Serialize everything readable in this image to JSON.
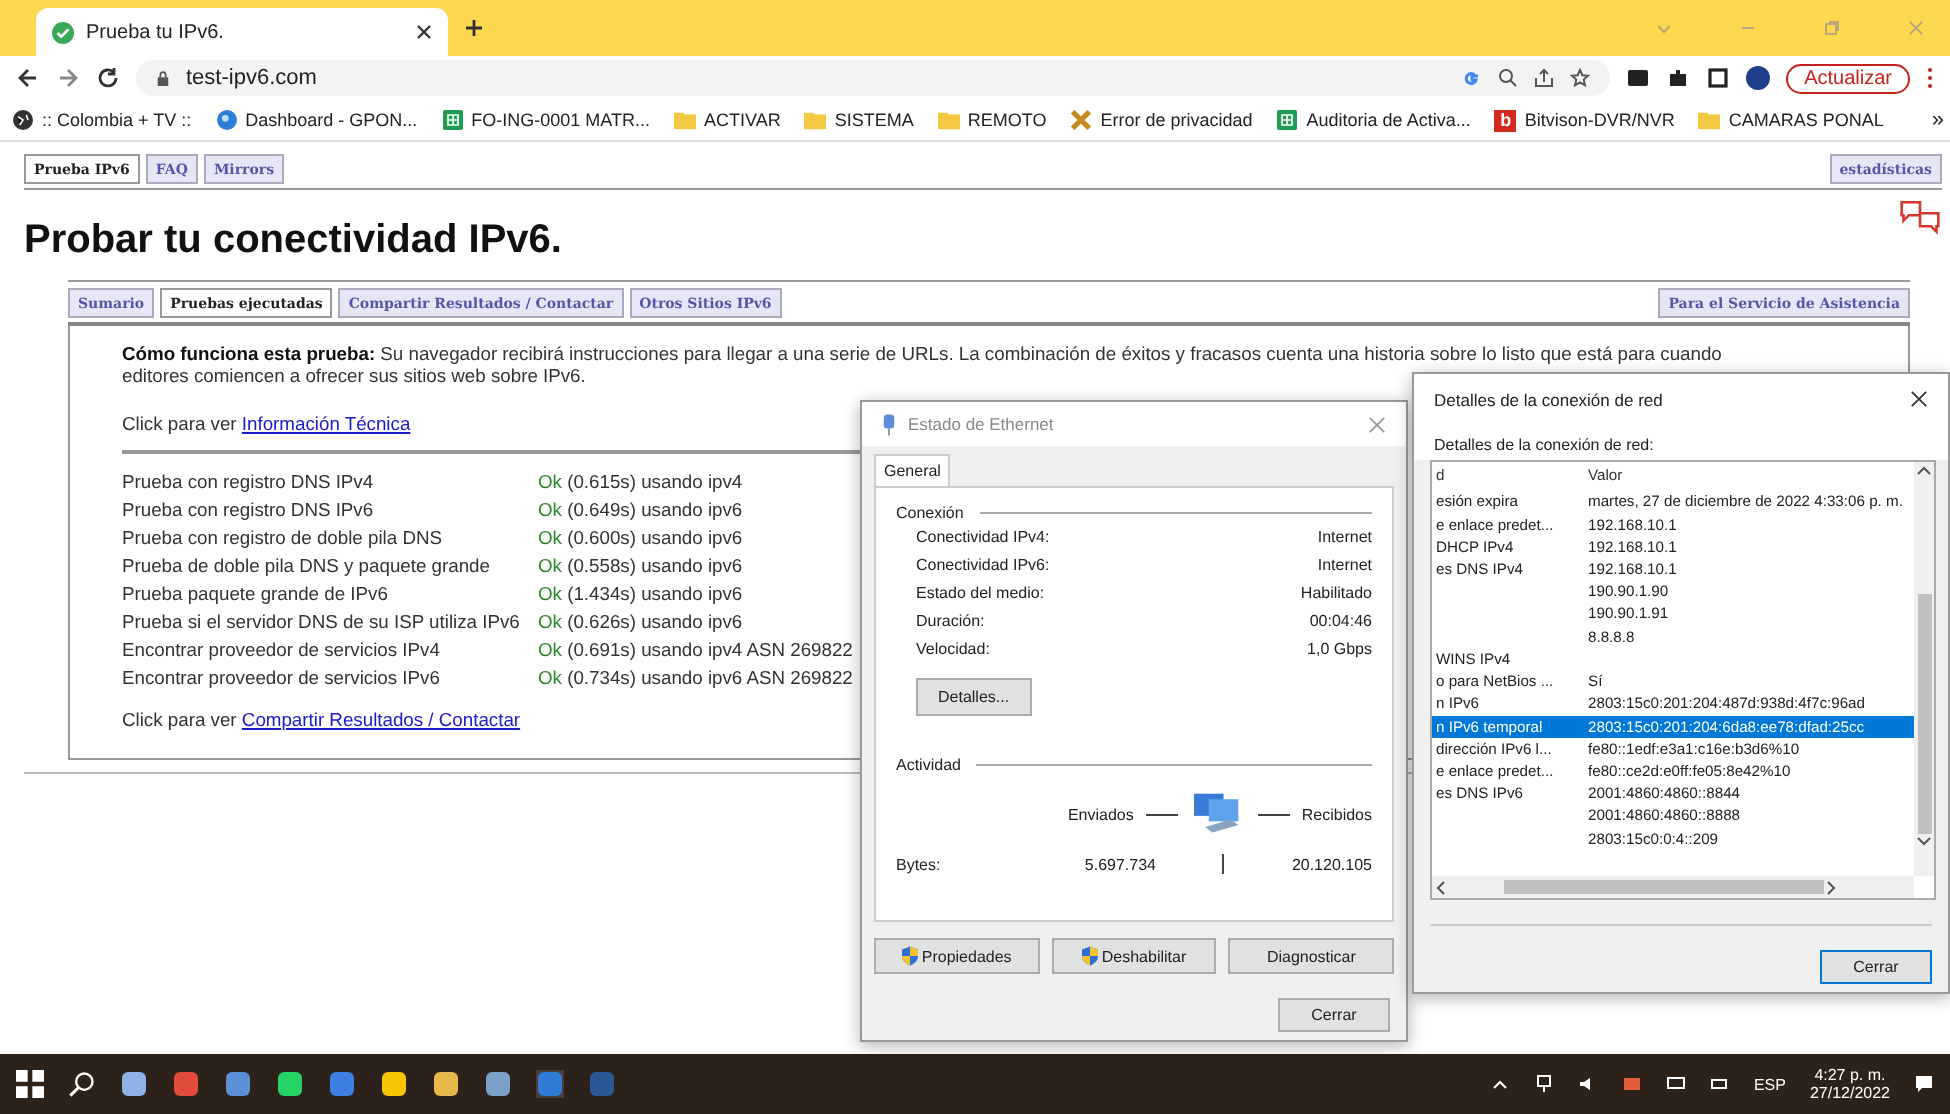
{
  "browser": {
    "tabs": [
      {
        "title": "Prueba tu IPv6.",
        "selected": true
      }
    ],
    "url": "test-ipv6.com",
    "update_button": "Actualizar",
    "bookmarks": [
      {
        "kind": "globe",
        "label": ":: Colombia + TV ::"
      },
      {
        "kind": "orb",
        "label": "Dashboard - GPON..."
      },
      {
        "kind": "sheet",
        "label": "FO-ING-0001 MATR..."
      },
      {
        "kind": "folder",
        "label": "ACTIVAR"
      },
      {
        "kind": "folder",
        "label": "SISTEMA"
      },
      {
        "kind": "folder",
        "label": "REMOTO"
      },
      {
        "kind": "warning",
        "label": "Error de privacidad"
      },
      {
        "kind": "sheet",
        "label": "Auditoria de Activa..."
      },
      {
        "kind": "letter",
        "letter": "b",
        "label": "Bitvison-DVR/NVR"
      },
      {
        "kind": "folder",
        "label": "CAMARAS PONAL"
      }
    ],
    "bookmarks_more": "»"
  },
  "page": {
    "top_tabs": [
      {
        "label": "Prueba IPv6",
        "selected": true
      },
      {
        "label": "FAQ",
        "selected": false
      },
      {
        "label": "Mirrors",
        "selected": false
      }
    ],
    "stats_link": "estadísticas",
    "title": "Probar tu conectividad IPv6.",
    "tabs": [
      {
        "label": "Sumario",
        "selected": false
      },
      {
        "label": "Pruebas ejecutadas",
        "selected": true
      },
      {
        "label": "Compartir Resultados / Contactar",
        "selected": false
      },
      {
        "label": "Otros Sitios IPv6",
        "selected": false
      }
    ],
    "support_tab": "Para el Servicio de Asistencia",
    "intro": "**Cómo funciona esta prueba:** Su navegador recibirá instrucciones para llegar a una serie de URLs. La combinación de éxitos y fracasos cuenta una historia sobre lo listo que está para cuando editores comiencen a ofrecer sus sitios web sobre IPv6.",
    "tech_prefix": "Click para ver",
    "tech_link": "Información Técnica",
    "tests": [
      {
        "name": "Prueba con registro DNS IPv4",
        "status": "Ok",
        "ok": true,
        "detail": "(0.615s) usando ipv4"
      },
      {
        "name": "Prueba con registro DNS IPv6",
        "status": "Ok",
        "ok": true,
        "detail": "(0.649s) usando ipv6"
      },
      {
        "name": "Prueba con registro de doble pila DNS",
        "status": "Ok",
        "ok": true,
        "detail": "(0.600s) usando ipv6"
      },
      {
        "name": "Prueba de doble pila DNS y paquete grande",
        "status": "Ok",
        "ok": true,
        "detail": "(0.558s) usando ipv6"
      },
      {
        "name": "Prueba paquete grande de IPv6",
        "status": "Ok",
        "ok": true,
        "detail": "(1.434s) usando ipv6"
      },
      {
        "name": "Prueba si el servidor DNS de su ISP utiliza IPv6",
        "status": "Ok",
        "ok": true,
        "detail": "(0.626s) usando ipv6"
      },
      {
        "name": "Encontrar proveedor de servicios IPv4",
        "status": "Ok",
        "ok": true,
        "detail": "(0.691s) usando ipv4 ASN 269822"
      },
      {
        "name": "Encontrar proveedor de servicios IPv6",
        "status": "Ok",
        "ok": true,
        "detail": "(0.734s) usando ipv6 ASN 269822"
      }
    ],
    "share_prefix": "Click para ver",
    "share_link": "Compartir Resultados / Contactar"
  },
  "ethernet_dialog": {
    "title": "Estado de Ethernet",
    "tabs": [
      {
        "label": "General",
        "selected": true
      }
    ],
    "connection_heading": "Conexión",
    "connection": [
      {
        "label": "Conectividad IPv4:",
        "value": "Internet"
      },
      {
        "label": "Conectividad IPv6:",
        "value": "Internet"
      },
      {
        "label": "Estado del medio:",
        "value": "Habilitado"
      },
      {
        "label": "Duración:",
        "value": "00:04:46"
      },
      {
        "label": "Velocidad:",
        "value": "1,0 Gbps"
      }
    ],
    "details_button": "Detalles...",
    "activity_heading": "Actividad",
    "sent_label": "Enviados",
    "received_label": "Recibidos",
    "bytes_label": "Bytes:",
    "bytes_sent": "5.697.734",
    "bytes_received": "20.120.105",
    "buttons": [
      {
        "label": "Propiedades",
        "shield": true
      },
      {
        "label": "Deshabilitar",
        "shield": true
      },
      {
        "label": "Diagnosticar",
        "shield": false
      }
    ],
    "close_button": "Cerrar"
  },
  "details_dialog": {
    "title": "Detalles de la conexión de red",
    "caption": "Detalles de la conexión de red:",
    "columns": [
      "d",
      "Valor"
    ],
    "rows": [
      {
        "name": "esión expira",
        "value": "martes, 27 de diciembre de 2022 4:33:06 p. m.",
        "selected": false
      },
      {
        "name": "e enlace predet...",
        "value": "192.168.10.1",
        "selected": false
      },
      {
        "name": "DHCP IPv4",
        "value": "192.168.10.1",
        "selected": false
      },
      {
        "name": "es DNS IPv4",
        "value": "192.168.10.1",
        "selected": false
      },
      {
        "value": "190.90.1.90",
        "selected": false
      },
      {
        "value": "190.90.1.91",
        "selected": false
      },
      {
        "value": "8.8.8.8",
        "selected": false
      },
      {
        "name": "WINS IPv4",
        "selected": false
      },
      {
        "name": "o para NetBios ...",
        "value": "Sí",
        "selected": false
      },
      {
        "name": "n IPv6",
        "value": "2803:15c0:201:204:487d:938d:4f7c:96ad",
        "selected": false
      },
      {
        "name": "n IPv6 temporal",
        "value": "2803:15c0:201:204:6da8:ee78:dfad:25cc",
        "selected": true
      },
      {
        "name": "dirección IPv6 l...",
        "value": "fe80::1edf:e3a1:c16e:b3d6%10",
        "selected": false
      },
      {
        "name": "e enlace predet...",
        "value": "fe80::ce2d:e0ff:fe05:8e42%10",
        "selected": false
      },
      {
        "name": "es DNS IPv6",
        "value": "2001:4860:4860::8844",
        "selected": false
      },
      {
        "value": "2001:4860:4860::8888",
        "selected": false
      },
      {
        "value": "2803:15c0:0:4::209",
        "selected": false
      }
    ],
    "close_button": "Cerrar"
  },
  "taskbar": {
    "language": "ESP",
    "time": "4:27 p. m.",
    "date": "27/12/2022"
  }
}
